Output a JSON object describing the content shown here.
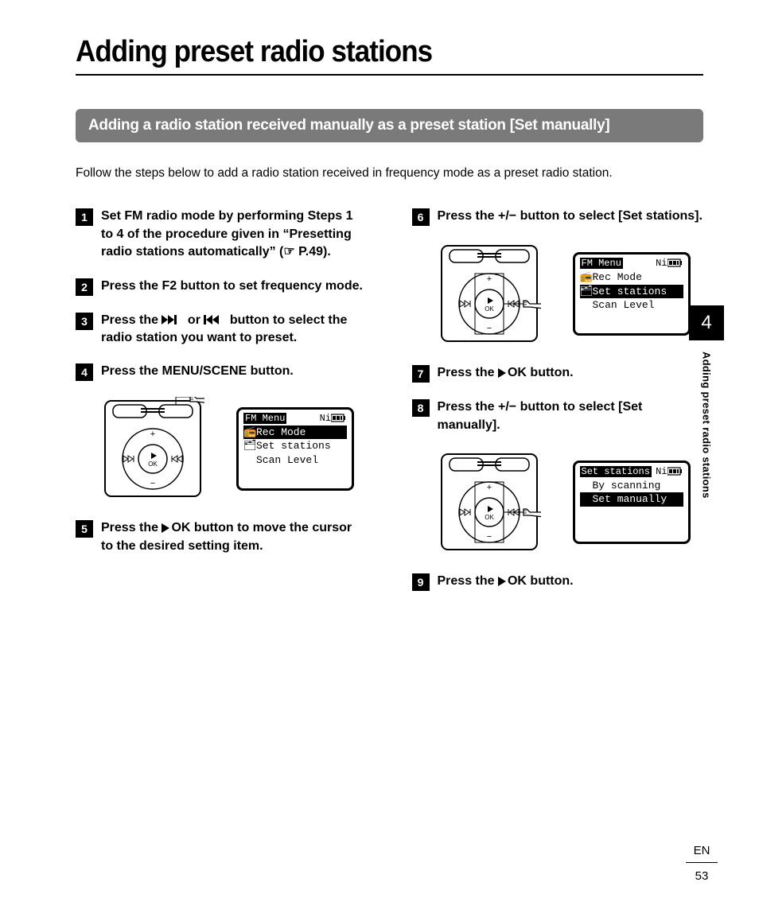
{
  "page_title": "Adding preset radio stations",
  "section_bar": "Adding a radio station received manually as a preset station [Set manually]",
  "intro": "Follow the steps below to add a radio station received in frequency mode as a preset radio station.",
  "steps": {
    "s1": {
      "num": "1",
      "pre": "Set FM radio mode by performing Steps 1 to 4 of the procedure given in “",
      "bold": "Presetting radio stations automatically",
      "post": "” (☞ P.49)."
    },
    "s2": {
      "num": "2",
      "pre": "Press the ",
      "bold": "F2",
      "post": " button to set frequency mode."
    },
    "s3": {
      "num": "3",
      "pre": "Press the ",
      "mid": " or ",
      "post": " button to select the radio station you want to preset."
    },
    "s4": {
      "num": "4",
      "pre": "Press the ",
      "bold": "MENU/SCENE",
      "post": " button."
    },
    "s5": {
      "num": "5",
      "pre": "Press the ",
      "bold": "OK",
      "post": " button to move the cursor to the desired setting item."
    },
    "s6": {
      "num": "6",
      "pre": "Press the ",
      "bold": "+/−",
      "post": " button to select [",
      "bold2": "Set stations",
      "post2": "]."
    },
    "s7": {
      "num": "7",
      "pre": "Press the ",
      "bold": "OK",
      "post": " button."
    },
    "s8": {
      "num": "8",
      "pre": "Press the ",
      "bold": "+/−",
      "post": " button to select [",
      "bold2": "Set manually",
      "post2": "]."
    },
    "s9": {
      "num": "9",
      "pre": "Press the ",
      "bold": "OK",
      "post": " button."
    }
  },
  "screen1": {
    "title": "FM Menu",
    "batt": "Ni",
    "line1": "Rec Mode",
    "line2": "Set stations",
    "line3": "Scan Level",
    "selected": 0
  },
  "screen2": {
    "title": "FM Menu",
    "batt": "Ni",
    "line1": "Rec Mode",
    "line2": "Set stations",
    "line3": "Scan Level",
    "selected": 1
  },
  "screen3": {
    "title": "Set stations",
    "batt": "Ni",
    "line1": "By scanning",
    "line2": "Set manually",
    "selected": 1
  },
  "side": {
    "chapter": "4",
    "label": "Adding preset radio stations"
  },
  "footer": {
    "lang": "EN",
    "page": "53"
  }
}
